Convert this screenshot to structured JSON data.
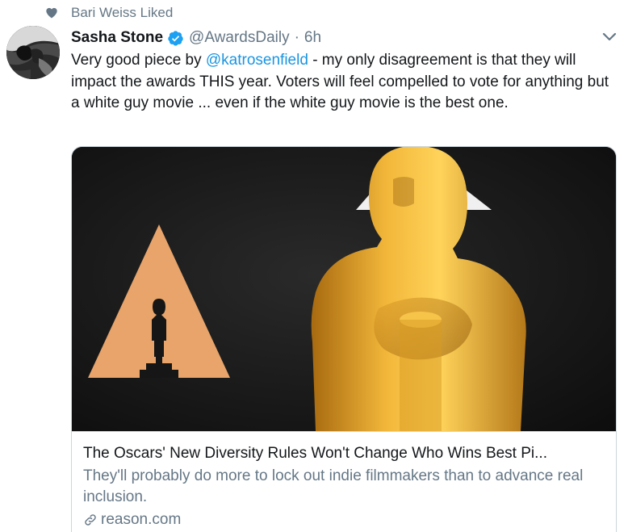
{
  "social_context": {
    "text": "Bari Weiss Liked"
  },
  "tweet": {
    "author_name": "Sasha Stone",
    "author_handle": "@AwardsDaily",
    "separator": "·",
    "timestamp": "6h",
    "text_before_mention": "Very good piece by ",
    "mention": "@katrosenfield",
    "text_after_mention": " - my only disagreement is that they will impact the awards THIS year. Voters will feel compelled to vote for anything but a white guy movie ... even if the white guy movie is the best one."
  },
  "card": {
    "title": "The Oscars' New Diversity Rules Won't Change Who Wins Best Pi...",
    "description": "They'll probably do more to lock out indie filmmakers than to advance real inclusion.",
    "domain": "reason.com"
  },
  "colors": {
    "text_primary": "#14171a",
    "text_secondary": "#657786",
    "link": "#1b95e0",
    "verified": "#1da1f2",
    "border": "#ccd6dd"
  }
}
